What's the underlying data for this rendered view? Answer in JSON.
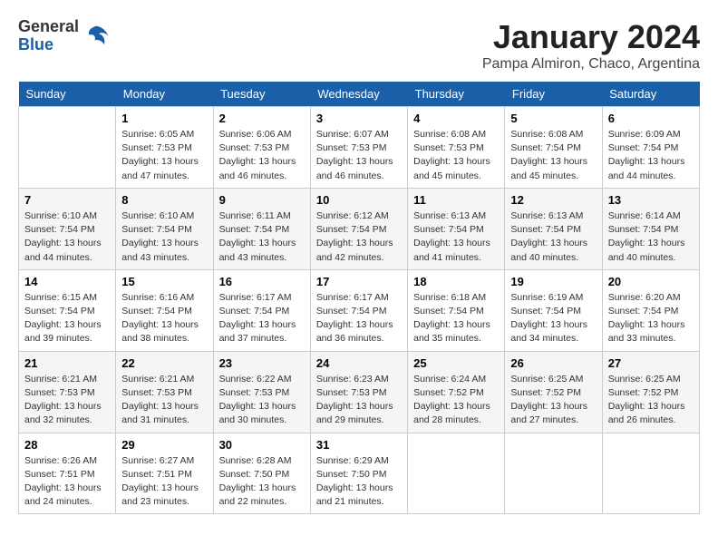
{
  "header": {
    "logo": {
      "general": "General",
      "blue": "Blue"
    },
    "title": "January 2024",
    "subtitle": "Pampa Almiron, Chaco, Argentina"
  },
  "days_of_week": [
    "Sunday",
    "Monday",
    "Tuesday",
    "Wednesday",
    "Thursday",
    "Friday",
    "Saturday"
  ],
  "weeks": [
    [
      {
        "day": "",
        "sunrise": "",
        "sunset": "",
        "daylight": ""
      },
      {
        "day": "1",
        "sunrise": "Sunrise: 6:05 AM",
        "sunset": "Sunset: 7:53 PM",
        "daylight": "Daylight: 13 hours and 47 minutes."
      },
      {
        "day": "2",
        "sunrise": "Sunrise: 6:06 AM",
        "sunset": "Sunset: 7:53 PM",
        "daylight": "Daylight: 13 hours and 46 minutes."
      },
      {
        "day": "3",
        "sunrise": "Sunrise: 6:07 AM",
        "sunset": "Sunset: 7:53 PM",
        "daylight": "Daylight: 13 hours and 46 minutes."
      },
      {
        "day": "4",
        "sunrise": "Sunrise: 6:08 AM",
        "sunset": "Sunset: 7:53 PM",
        "daylight": "Daylight: 13 hours and 45 minutes."
      },
      {
        "day": "5",
        "sunrise": "Sunrise: 6:08 AM",
        "sunset": "Sunset: 7:54 PM",
        "daylight": "Daylight: 13 hours and 45 minutes."
      },
      {
        "day": "6",
        "sunrise": "Sunrise: 6:09 AM",
        "sunset": "Sunset: 7:54 PM",
        "daylight": "Daylight: 13 hours and 44 minutes."
      }
    ],
    [
      {
        "day": "7",
        "sunrise": "Sunrise: 6:10 AM",
        "sunset": "Sunset: 7:54 PM",
        "daylight": "Daylight: 13 hours and 44 minutes."
      },
      {
        "day": "8",
        "sunrise": "Sunrise: 6:10 AM",
        "sunset": "Sunset: 7:54 PM",
        "daylight": "Daylight: 13 hours and 43 minutes."
      },
      {
        "day": "9",
        "sunrise": "Sunrise: 6:11 AM",
        "sunset": "Sunset: 7:54 PM",
        "daylight": "Daylight: 13 hours and 43 minutes."
      },
      {
        "day": "10",
        "sunrise": "Sunrise: 6:12 AM",
        "sunset": "Sunset: 7:54 PM",
        "daylight": "Daylight: 13 hours and 42 minutes."
      },
      {
        "day": "11",
        "sunrise": "Sunrise: 6:13 AM",
        "sunset": "Sunset: 7:54 PM",
        "daylight": "Daylight: 13 hours and 41 minutes."
      },
      {
        "day": "12",
        "sunrise": "Sunrise: 6:13 AM",
        "sunset": "Sunset: 7:54 PM",
        "daylight": "Daylight: 13 hours and 40 minutes."
      },
      {
        "day": "13",
        "sunrise": "Sunrise: 6:14 AM",
        "sunset": "Sunset: 7:54 PM",
        "daylight": "Daylight: 13 hours and 40 minutes."
      }
    ],
    [
      {
        "day": "14",
        "sunrise": "Sunrise: 6:15 AM",
        "sunset": "Sunset: 7:54 PM",
        "daylight": "Daylight: 13 hours and 39 minutes."
      },
      {
        "day": "15",
        "sunrise": "Sunrise: 6:16 AM",
        "sunset": "Sunset: 7:54 PM",
        "daylight": "Daylight: 13 hours and 38 minutes."
      },
      {
        "day": "16",
        "sunrise": "Sunrise: 6:17 AM",
        "sunset": "Sunset: 7:54 PM",
        "daylight": "Daylight: 13 hours and 37 minutes."
      },
      {
        "day": "17",
        "sunrise": "Sunrise: 6:17 AM",
        "sunset": "Sunset: 7:54 PM",
        "daylight": "Daylight: 13 hours and 36 minutes."
      },
      {
        "day": "18",
        "sunrise": "Sunrise: 6:18 AM",
        "sunset": "Sunset: 7:54 PM",
        "daylight": "Daylight: 13 hours and 35 minutes."
      },
      {
        "day": "19",
        "sunrise": "Sunrise: 6:19 AM",
        "sunset": "Sunset: 7:54 PM",
        "daylight": "Daylight: 13 hours and 34 minutes."
      },
      {
        "day": "20",
        "sunrise": "Sunrise: 6:20 AM",
        "sunset": "Sunset: 7:54 PM",
        "daylight": "Daylight: 13 hours and 33 minutes."
      }
    ],
    [
      {
        "day": "21",
        "sunrise": "Sunrise: 6:21 AM",
        "sunset": "Sunset: 7:53 PM",
        "daylight": "Daylight: 13 hours and 32 minutes."
      },
      {
        "day": "22",
        "sunrise": "Sunrise: 6:21 AM",
        "sunset": "Sunset: 7:53 PM",
        "daylight": "Daylight: 13 hours and 31 minutes."
      },
      {
        "day": "23",
        "sunrise": "Sunrise: 6:22 AM",
        "sunset": "Sunset: 7:53 PM",
        "daylight": "Daylight: 13 hours and 30 minutes."
      },
      {
        "day": "24",
        "sunrise": "Sunrise: 6:23 AM",
        "sunset": "Sunset: 7:53 PM",
        "daylight": "Daylight: 13 hours and 29 minutes."
      },
      {
        "day": "25",
        "sunrise": "Sunrise: 6:24 AM",
        "sunset": "Sunset: 7:52 PM",
        "daylight": "Daylight: 13 hours and 28 minutes."
      },
      {
        "day": "26",
        "sunrise": "Sunrise: 6:25 AM",
        "sunset": "Sunset: 7:52 PM",
        "daylight": "Daylight: 13 hours and 27 minutes."
      },
      {
        "day": "27",
        "sunrise": "Sunrise: 6:25 AM",
        "sunset": "Sunset: 7:52 PM",
        "daylight": "Daylight: 13 hours and 26 minutes."
      }
    ],
    [
      {
        "day": "28",
        "sunrise": "Sunrise: 6:26 AM",
        "sunset": "Sunset: 7:51 PM",
        "daylight": "Daylight: 13 hours and 24 minutes."
      },
      {
        "day": "29",
        "sunrise": "Sunrise: 6:27 AM",
        "sunset": "Sunset: 7:51 PM",
        "daylight": "Daylight: 13 hours and 23 minutes."
      },
      {
        "day": "30",
        "sunrise": "Sunrise: 6:28 AM",
        "sunset": "Sunset: 7:50 PM",
        "daylight": "Daylight: 13 hours and 22 minutes."
      },
      {
        "day": "31",
        "sunrise": "Sunrise: 6:29 AM",
        "sunset": "Sunset: 7:50 PM",
        "daylight": "Daylight: 13 hours and 21 minutes."
      },
      {
        "day": "",
        "sunrise": "",
        "sunset": "",
        "daylight": ""
      },
      {
        "day": "",
        "sunrise": "",
        "sunset": "",
        "daylight": ""
      },
      {
        "day": "",
        "sunrise": "",
        "sunset": "",
        "daylight": ""
      }
    ]
  ]
}
